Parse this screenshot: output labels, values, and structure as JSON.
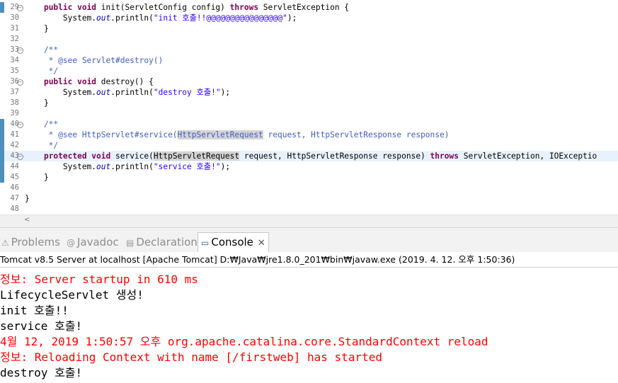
{
  "editor": {
    "lines": [
      {
        "num": "29",
        "fold": "−",
        "mark": true,
        "parts": [
          [
            "",
            "    "
          ],
          [
            "kw",
            "public void"
          ],
          [
            "",
            " init(ServletConfig config) "
          ],
          [
            "kw",
            "throws"
          ],
          [
            "",
            " ServletException {"
          ]
        ]
      },
      {
        "num": "30",
        "parts": [
          [
            "",
            "        System."
          ],
          [
            "fld",
            "out"
          ],
          [
            "",
            ".println("
          ],
          [
            "str",
            "\"init 호출!!@@@@@@@@@@@@@@@@\""
          ],
          [
            "",
            ");"
          ]
        ]
      },
      {
        "num": "31",
        "parts": [
          [
            "",
            "    }"
          ]
        ]
      },
      {
        "num": "32",
        "parts": []
      },
      {
        "num": "33",
        "fold": "−",
        "parts": [
          [
            "doc",
            "    /**"
          ]
        ]
      },
      {
        "num": "34",
        "parts": [
          [
            "doc",
            "     * @see Servlet#destroy()"
          ]
        ]
      },
      {
        "num": "35",
        "parts": [
          [
            "doc",
            "     */"
          ]
        ]
      },
      {
        "num": "36",
        "fold": "−",
        "parts": [
          [
            "",
            "    "
          ],
          [
            "kw",
            "public void"
          ],
          [
            "",
            " destroy() {"
          ]
        ]
      },
      {
        "num": "37",
        "parts": [
          [
            "",
            "        System."
          ],
          [
            "fld",
            "out"
          ],
          [
            "",
            ".println("
          ],
          [
            "str",
            "\"destroy 호출!\""
          ],
          [
            "",
            ");"
          ]
        ]
      },
      {
        "num": "38",
        "parts": [
          [
            "",
            "    }"
          ]
        ]
      },
      {
        "num": "39",
        "parts": []
      },
      {
        "num": "40",
        "fold": "−",
        "mark": true,
        "parts": [
          [
            "doc",
            "    /**"
          ]
        ]
      },
      {
        "num": "41",
        "mark": true,
        "parts": [
          [
            "doc",
            "     * @see HttpServlet#service("
          ],
          [
            "doc hl",
            "HttpServletRequest"
          ],
          [
            "doc",
            " request, HttpServletResponse response)"
          ]
        ]
      },
      {
        "num": "42",
        "mark": true,
        "parts": [
          [
            "doc",
            "     */"
          ]
        ]
      },
      {
        "num": "43",
        "fold": "−",
        "mark": true,
        "current": true,
        "parts": [
          [
            "",
            "    "
          ],
          [
            "kw",
            "protected void"
          ],
          [
            "",
            " service("
          ],
          [
            "hl",
            "HttpServletRequest"
          ],
          [
            "",
            " request, HttpServletResponse response) "
          ],
          [
            "kw",
            "throws"
          ],
          [
            "",
            " ServletException, IOExceptio"
          ]
        ]
      },
      {
        "num": "44",
        "mark": true,
        "parts": [
          [
            "",
            "        System."
          ],
          [
            "fld",
            "out"
          ],
          [
            "",
            ".println("
          ],
          [
            "str",
            "\"service 호출!\""
          ],
          [
            "",
            ");"
          ]
        ]
      },
      {
        "num": "45",
        "mark": true,
        "parts": [
          [
            "",
            "    }"
          ]
        ]
      },
      {
        "num": "46",
        "parts": []
      },
      {
        "num": "47",
        "parts": [
          [
            "",
            "}"
          ]
        ]
      },
      {
        "num": "48",
        "parts": []
      }
    ]
  },
  "scrollbar": {
    "left_arrow": "<"
  },
  "tabs": [
    {
      "label": "Problems",
      "icon": "problems-icon",
      "glyph": "⚠",
      "active": false
    },
    {
      "label": "Javadoc",
      "icon": "javadoc-icon",
      "glyph": "@",
      "active": false
    },
    {
      "label": "Declaration",
      "icon": "declaration-icon",
      "glyph": "▤",
      "active": false
    },
    {
      "label": "Console",
      "icon": "console-icon",
      "glyph": "▭",
      "active": true,
      "close": "✕"
    }
  ],
  "console": {
    "header": "Tomcat v8.5 Server at localhost [Apache Tomcat] D:₩Java₩jre1.8.0_201₩bin₩javaw.exe (2019. 4. 12. 오후 1:50:36)",
    "lines": [
      {
        "text": "정보: Server startup in 610 ms",
        "color": "red"
      },
      {
        "text": "LifecycleServlet 생성!",
        "color": "black"
      },
      {
        "text": "init 호출!!",
        "color": "black"
      },
      {
        "text": "service 호출!",
        "color": "black"
      },
      {
        "text": "4월 12, 2019 1:50:57 오후 org.apache.catalina.core.StandardContext reload",
        "color": "red"
      },
      {
        "text": "정보: Reloading Context with name [/firstweb] has started",
        "color": "red"
      },
      {
        "text": "destroy 호출!",
        "color": "black"
      }
    ]
  },
  "colors": {
    "keyword": "#7f0055",
    "string": "#2a00ff",
    "javadoc": "#3f5fbf",
    "error": "#ff0000",
    "change_marker": "#4d8fbd"
  }
}
